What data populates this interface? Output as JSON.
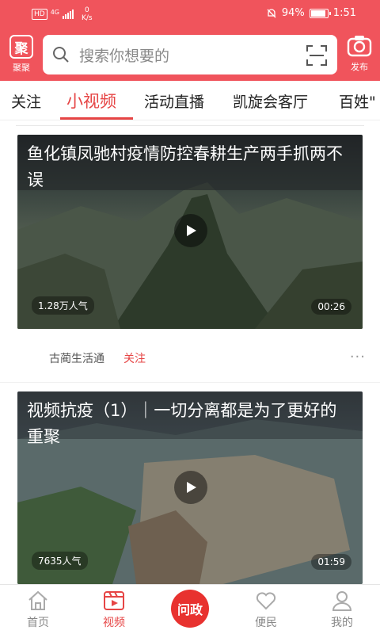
{
  "status_bar": {
    "network": "HD",
    "signal_type": "4G",
    "speed_value": "0",
    "speed_unit": "K/s",
    "battery": "94%",
    "battery_level": 0.94,
    "time": "1:51"
  },
  "header": {
    "logo_label": "聚聚",
    "logo_glyph": "聚",
    "search_placeholder": "搜索你想要的",
    "publish_label": "发布"
  },
  "tabs": [
    {
      "label": "关注"
    },
    {
      "label": "小视频",
      "active": true
    },
    {
      "label": "活动直播"
    },
    {
      "label": "凯旋会客厅"
    },
    {
      "label": "百姓\""
    }
  ],
  "feed": {
    "items": [
      {
        "title": "鱼化镇凤驰村疫情防控春耕生产两手抓两不误",
        "views": "1.28万人气",
        "duration": "00:26",
        "author": "古蔺生活通",
        "follow_label": "关注",
        "more": "···"
      },
      {
        "title": "视频抗疫（1）｜一切分离都是为了更好的重聚",
        "views": "7635人气",
        "duration": "01:59"
      }
    ]
  },
  "bottom_nav": {
    "items": [
      {
        "label": "首页",
        "icon": "home-icon"
      },
      {
        "label": "视频",
        "icon": "video-icon",
        "active": true
      },
      {
        "label": "问政",
        "icon": "wenzheng-icon"
      },
      {
        "label": "便民",
        "icon": "heart-icon"
      },
      {
        "label": "我的",
        "icon": "user-icon"
      }
    ]
  },
  "colors": {
    "brand": "#f0545c",
    "accent": "#e64545"
  }
}
